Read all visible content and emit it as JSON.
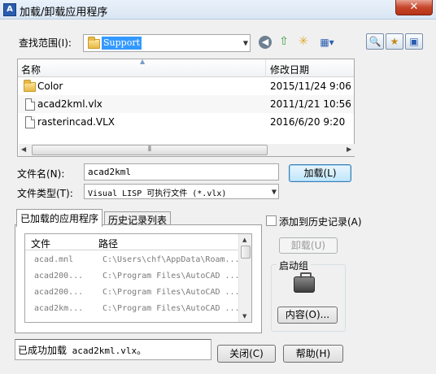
{
  "window": {
    "title": "加载/卸载应用程序",
    "icon_letter": "A"
  },
  "lookin": {
    "label": "查找范围(I):",
    "value": "Support"
  },
  "toolbar_icons": [
    "back-icon",
    "up-folder-icon",
    "new-folder-icon",
    "views-icon",
    "find-icon",
    "favorites-icon",
    "tools-icon"
  ],
  "filelist": {
    "columns": [
      "名称",
      "修改日期"
    ],
    "rows": [
      {
        "name": "Color",
        "date": "2015/11/24 9:06",
        "type": "folder"
      },
      {
        "name": "acad2kml.vlx",
        "date": "2011/1/21 10:56",
        "type": "file"
      },
      {
        "name": "rasterincad.VLX",
        "date": "2016/6/20 9:20",
        "type": "file"
      }
    ]
  },
  "filename": {
    "label": "文件名(N):",
    "value": "acad2kml"
  },
  "filetype": {
    "label": "文件类型(T):",
    "value": "Visual LISP 可执行文件 (*.vlx)"
  },
  "load_button": "加载(L)",
  "tabs": [
    "已加载的应用程序",
    "历史记录列表"
  ],
  "loaded": {
    "columns": [
      "文件",
      "路径"
    ],
    "rows": [
      {
        "file": "acad.mnl",
        "path": "C:\\Users\\chf\\AppData\\Roam..."
      },
      {
        "file": "acad200...",
        "path": "C:\\Program Files\\AutoCAD ..."
      },
      {
        "file": "acad200...",
        "path": "C:\\Program Files\\AutoCAD ..."
      },
      {
        "file": "acad2km...",
        "path": "C:\\Program Files\\AutoCAD ..."
      }
    ]
  },
  "add_history": {
    "label": "添加到历史记录(A)",
    "checked": false
  },
  "unload_button": "卸载(U)",
  "startup": {
    "title": "启动组",
    "contents_button": "内容(O)..."
  },
  "status": {
    "prefix": "已成功加载",
    "file": "acad2kml.vlx",
    "suffix": "。"
  },
  "close_button": "关闭(C)",
  "help_button": "帮助(H)",
  "colors": {
    "selection": "#3399ff",
    "title_bg": "#dbe7f4",
    "close": "#c7462b"
  }
}
